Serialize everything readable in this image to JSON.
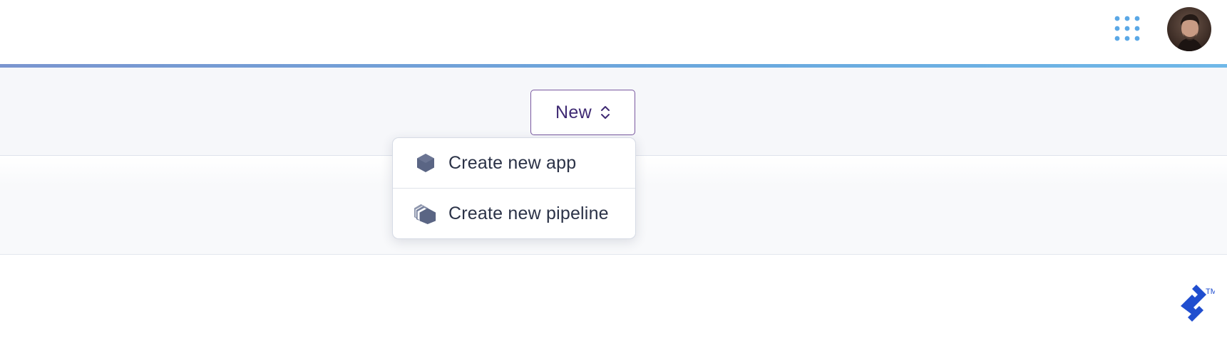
{
  "header": {
    "apps_icon": "apps-grid-icon",
    "avatar_icon": "user-avatar"
  },
  "toolbar": {
    "new_button_label": "New",
    "new_button_icon": "chevron-up-down-icon"
  },
  "new_menu": {
    "items": [
      {
        "label": "Create new app",
        "icon": "app-hexagon-icon"
      },
      {
        "label": "Create new pipeline",
        "icon": "pipeline-stack-icon"
      }
    ]
  },
  "watermark": {
    "trademark": "TM"
  },
  "colors": {
    "accent_purple": "#3f2a73",
    "button_border": "#79589f",
    "apps_dots": "#5aa8e6",
    "accent_line": "#6fa6dc",
    "menu_icon": "#5a6584",
    "brand_blue": "#204ecf"
  }
}
